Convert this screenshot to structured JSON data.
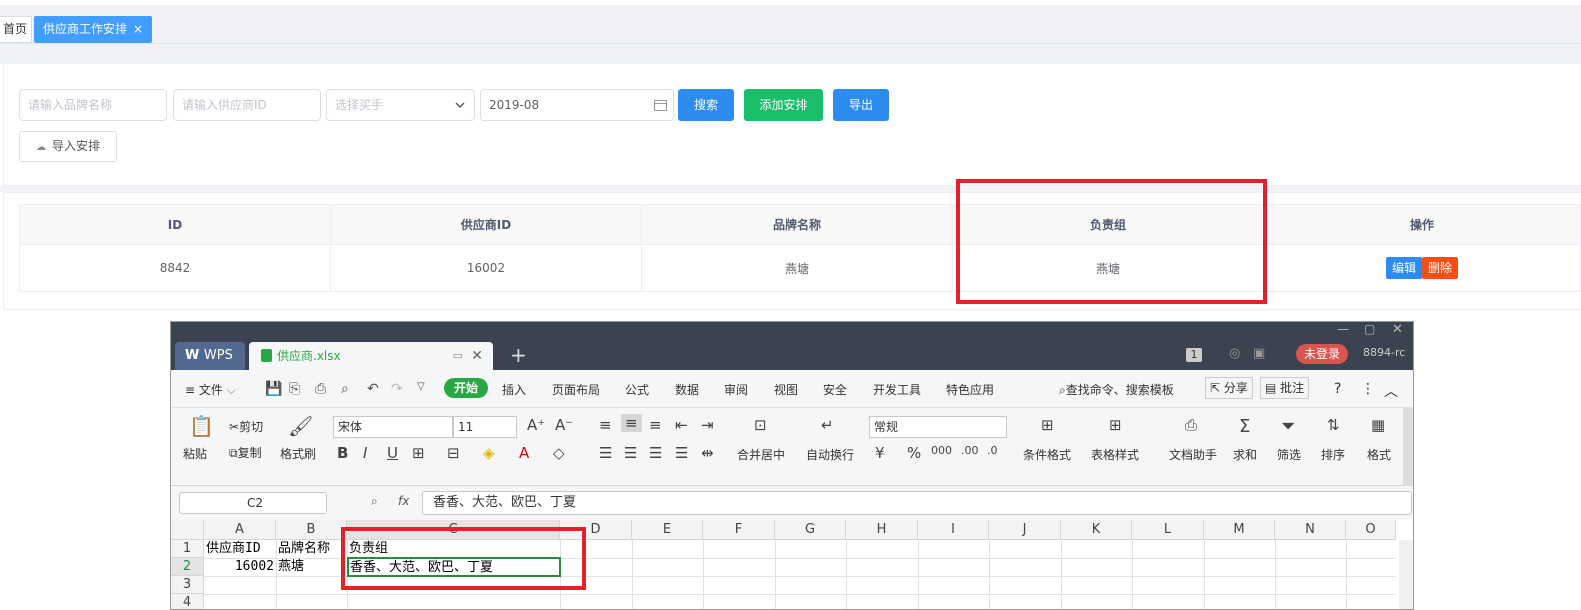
{
  "tabs": {
    "home": "首页",
    "active": "供应商工作安排",
    "close": "×"
  },
  "filters": {
    "brand_placeholder": "请输入品牌名称",
    "supplier_placeholder": "请输入供应商ID",
    "buyer_placeholder": "选择买手",
    "month_value": "2019-08",
    "search": "搜索",
    "add": "添加安排",
    "export": "导出",
    "import": "导入安排"
  },
  "colors": {
    "primary": "#409eff",
    "success": "#13c66b",
    "danger": "#f44e12",
    "highlight": "#e0232a"
  },
  "table": {
    "headers": [
      "ID",
      "供应商ID",
      "品牌名称",
      "负责组",
      "操作"
    ],
    "rows": [
      {
        "id": "8842",
        "supplier_id": "16002",
        "brand": "燕塘",
        "group": "燕塘",
        "edit": "编辑",
        "delete": "删除"
      }
    ]
  },
  "wps": {
    "app": "WPS",
    "file": "供应商.xlsx",
    "new_tab": "+",
    "badge": "1",
    "login": "未登录",
    "user": "8894-rc",
    "menu": [
      "文件",
      "开始",
      "插入",
      "页面布局",
      "公式",
      "数据",
      "审阅",
      "视图",
      "安全",
      "开发工具",
      "特色应用"
    ],
    "search_cmd": "查找命令、搜索模板",
    "share": "分享",
    "comment": "批注",
    "ribbon": {
      "paste": "粘贴",
      "cut": "剪切",
      "copy": "复制",
      "format_painter": "格式刷",
      "font": "宋体",
      "size": "11",
      "merge": "合并居中",
      "wrap": "自动换行",
      "number_format": "常规",
      "cond_format": "条件格式",
      "table_style": "表格样式",
      "doc_helper": "文档助手",
      "sum": "求和",
      "filter": "筛选",
      "sort": "排序",
      "format": "格式"
    },
    "name_box": "C2",
    "fx": "fx",
    "formula": "香香、大范、欧巴、丁夏",
    "columns": [
      "A",
      "B",
      "C",
      "D",
      "E",
      "F",
      "G",
      "H",
      "I",
      "J",
      "K",
      "L",
      "M",
      "N",
      "O"
    ],
    "rows": [
      "1",
      "2",
      "3",
      "4"
    ],
    "cells": {
      "A1": "供应商ID",
      "B1": "品牌名称",
      "C1": "负责组",
      "A2": "16002",
      "B2": "燕塘",
      "C2": "香香、大范、欧巴、丁夏"
    }
  }
}
